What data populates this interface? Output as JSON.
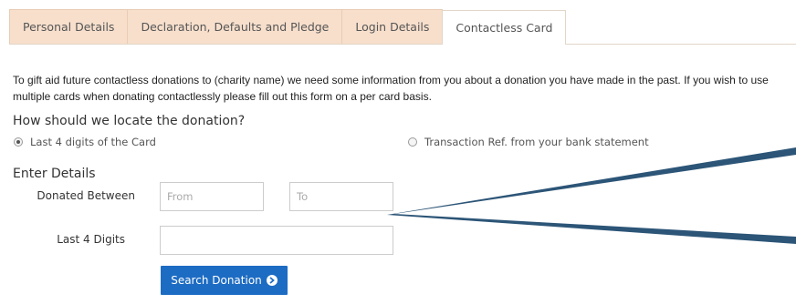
{
  "tabs": [
    {
      "label": "Personal Details"
    },
    {
      "label": "Declaration, Defaults and Pledge"
    },
    {
      "label": "Login Details"
    },
    {
      "label": "Contactless Card"
    }
  ],
  "intro_text": "To gift aid future contactless donations to (charity name) we need some information from you about a donation you have made in the past. If you wish to use multiple cards when donating contactlessly please fill out this form on a per card basis.",
  "locate": {
    "heading": "How should we locate the donation?",
    "option_card": "Last 4 digits of the Card",
    "option_transaction": "Transaction Ref. from your bank statement",
    "selected": "option_card"
  },
  "details": {
    "heading": "Enter Details",
    "donated_between_label": "Donated Between",
    "from_placeholder": "From",
    "to_placeholder": "To",
    "last4_label": "Last 4 Digits",
    "last4_value": ""
  },
  "search_button": "Search Donation",
  "colors": {
    "tab_bg": "#f7dfcc",
    "button_bg": "#1d6cc3",
    "pointer_line": "#2c5577"
  }
}
